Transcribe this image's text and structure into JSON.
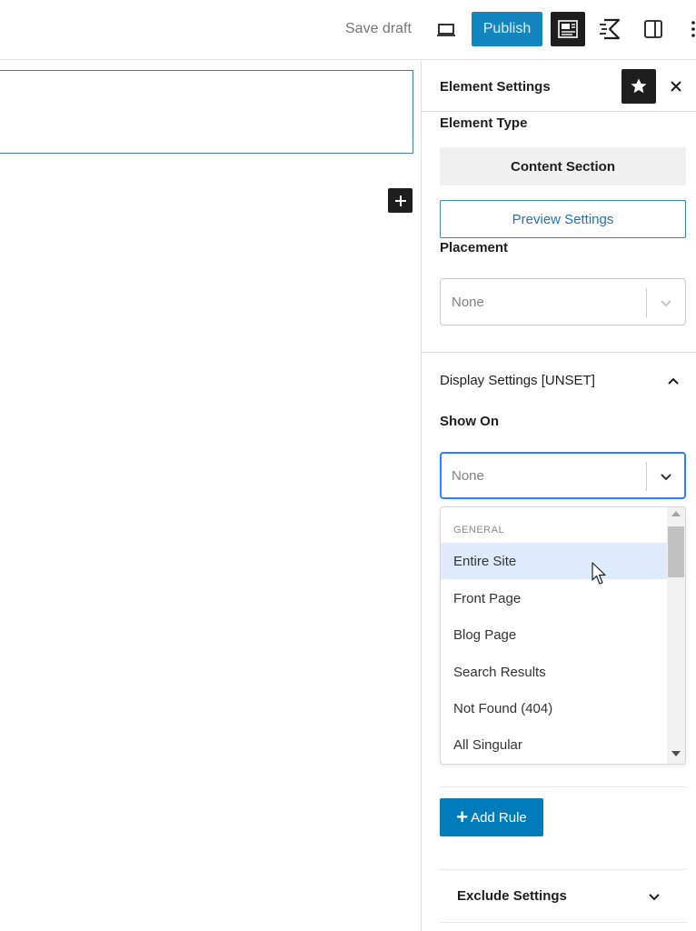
{
  "toolbar": {
    "save_draft": "Save draft",
    "publish": "Publish",
    "icons": [
      "desktop-preview-icon",
      "settings-icon",
      "performance-icon",
      "sidebar-toggle-icon",
      "more-options-icon"
    ]
  },
  "sidebar": {
    "title": "Element Settings",
    "element_type_label": "Element Type",
    "element_type_value": "Content Section",
    "preview_settings": "Preview Settings",
    "placement_label": "Placement",
    "placement_value": "None",
    "display_settings_heading": "Display Settings [UNSET]",
    "show_on_label": "Show On",
    "show_on_value": "None",
    "add_rule": "Add Rule",
    "exclude_heading": "Exclude Settings"
  },
  "dropdown": {
    "group": "GENERAL",
    "items": [
      "Entire Site",
      "Front Page",
      "Blog Page",
      "Search Results",
      "Not Found (404)",
      "All Singular"
    ],
    "highlighted": "Entire Site"
  },
  "colors": {
    "accent": "#007cba",
    "focus": "#2684ff",
    "highlight": "#deebff",
    "dark": "#1e1e1e"
  }
}
